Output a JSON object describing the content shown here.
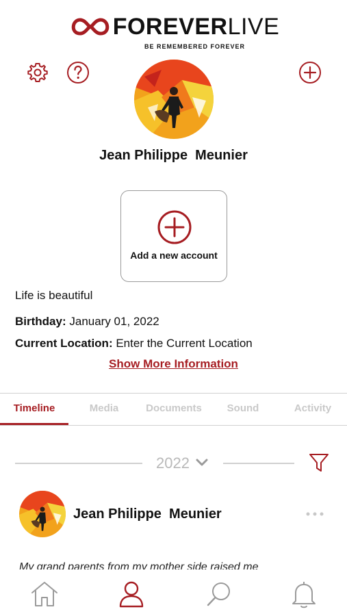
{
  "brand": {
    "name_bold": "FOREVER",
    "name_thin": "LIVE",
    "tagline": "BE REMEMBERED FOREVER"
  },
  "colors": {
    "accent": "#a61d22",
    "muted_tab": "#c9c9c9",
    "divider": "#d0d0d0"
  },
  "header_icons": [
    "gear-icon",
    "help-icon",
    "add-circle-icon"
  ],
  "profile": {
    "name": "Jean Philippe  Meunier"
  },
  "add_account": {
    "label": "Add a new account"
  },
  "about": {
    "bio": "Life is beautiful",
    "birthday_label": "Birthday:",
    "birthday_value": "January 01, 2022",
    "location_label": "Current Location:",
    "location_value": "Enter the Current Location",
    "show_more": "Show More Information"
  },
  "tabs": [
    {
      "label": "Timeline",
      "active": true
    },
    {
      "label": "Media",
      "active": false
    },
    {
      "label": "Documents",
      "active": false
    },
    {
      "label": "Sound",
      "active": false
    },
    {
      "label": "Activity",
      "active": false
    }
  ],
  "timeline": {
    "year": "2022"
  },
  "post": {
    "author": "Jean Philippe  Meunier",
    "text": "My grand parents from my mother side raised me"
  },
  "bottom_nav": [
    "home-icon",
    "profile-icon",
    "search-icon",
    "bell-icon"
  ]
}
